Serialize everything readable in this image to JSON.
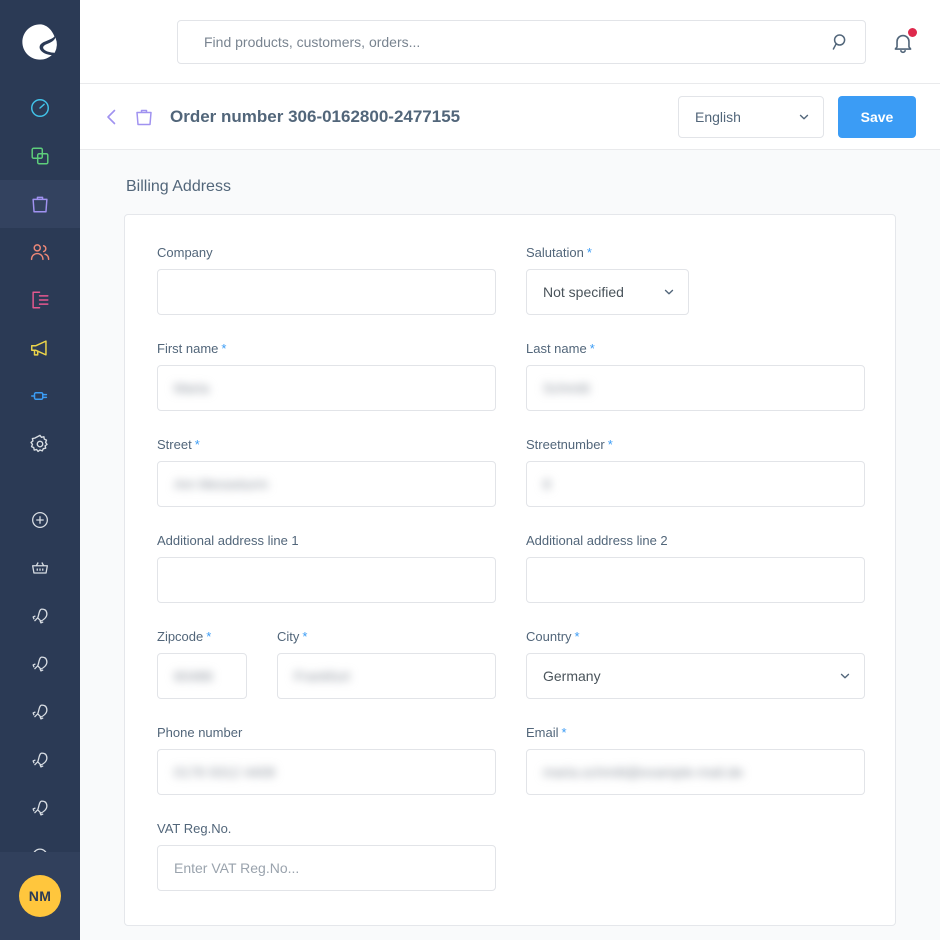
{
  "sidebar": {
    "logo_name": "shopware-logo",
    "avatar_initials": "NM",
    "items": [
      {
        "name": "dashboard",
        "icon": "dashboard-icon",
        "color": "#41c3e9",
        "active": false
      },
      {
        "name": "catalogues",
        "icon": "catalogues-icon",
        "color": "#5ece7b",
        "active": false
      },
      {
        "name": "orders",
        "icon": "orders-icon",
        "color": "#a092f0",
        "active": true
      },
      {
        "name": "customers",
        "icon": "customers-icon",
        "color": "#ed8877",
        "active": false
      },
      {
        "name": "content",
        "icon": "content-icon",
        "color": "#e5588f",
        "active": false
      },
      {
        "name": "marketing",
        "icon": "marketing-icon",
        "color": "#ecd54a",
        "active": false
      },
      {
        "name": "extensions",
        "icon": "extensions-icon",
        "color": "#3b9cf5",
        "active": false
      },
      {
        "name": "settings",
        "icon": "gear-icon",
        "color": "#d8dde3",
        "active": false
      }
    ],
    "apps": [
      {
        "name": "add-app",
        "icon": "plus-circle-icon",
        "color": "#d8dde3"
      },
      {
        "name": "basket-app",
        "icon": "basket-icon",
        "color": "#d8dde3"
      },
      {
        "name": "rocket-app-1",
        "icon": "rocket-icon",
        "color": "#d8dde3"
      },
      {
        "name": "rocket-app-2",
        "icon": "rocket-icon",
        "color": "#d8dde3"
      },
      {
        "name": "rocket-app-3",
        "icon": "rocket-icon",
        "color": "#d8dde3"
      },
      {
        "name": "rocket-app-4",
        "icon": "rocket-icon",
        "color": "#d8dde3"
      },
      {
        "name": "rocket-app-5",
        "icon": "rocket-icon",
        "color": "#d8dde3"
      },
      {
        "name": "expand",
        "icon": "chevron-right-circle-icon",
        "color": "#d8dde3"
      }
    ]
  },
  "search": {
    "placeholder": "Find products, customers, orders...",
    "value": "",
    "icon": "search-icon"
  },
  "notifications": {
    "icon": "bell-icon",
    "has_unread": true,
    "dot_color": "#de294c"
  },
  "toolbar": {
    "back_icon": "chevron-left-icon",
    "order_icon": "orders-icon",
    "title": "Order number 306-0162800-2477155",
    "language": {
      "selected": "English",
      "chevron": "chevron-down-icon"
    },
    "save_label": "Save",
    "save_color": "#3b9cf5"
  },
  "main": {
    "section_title": "Billing Address",
    "fields": {
      "company": {
        "label": "Company",
        "required": false,
        "value": "",
        "placeholder": "",
        "redacted": false
      },
      "salutation": {
        "label": "Salutation",
        "required": true,
        "value": "Not specified",
        "type": "select"
      },
      "first_name": {
        "label": "First name",
        "required": true,
        "value": "Maria",
        "redacted": true
      },
      "last_name": {
        "label": "Last name",
        "required": true,
        "value": "Schmitt",
        "redacted": true
      },
      "street": {
        "label": "Street",
        "required": true,
        "value": "Am Messeturm",
        "redacted": true
      },
      "streetnumber": {
        "label": "Streetnumber",
        "required": true,
        "value": "8",
        "redacted": true
      },
      "address_1": {
        "label": "Additional address line 1",
        "required": false,
        "value": "",
        "placeholder": "",
        "redacted": false
      },
      "address_2": {
        "label": "Additional address line 2",
        "required": false,
        "value": "",
        "placeholder": "",
        "redacted": false
      },
      "zipcode": {
        "label": "Zipcode",
        "required": true,
        "value": "60486",
        "redacted": true
      },
      "city": {
        "label": "City",
        "required": true,
        "value": "Frankfurt",
        "redacted": true
      },
      "country": {
        "label": "Country",
        "required": true,
        "value": "Germany",
        "type": "select"
      },
      "phone": {
        "label": "Phone number",
        "required": false,
        "value": "0176 9312 4408",
        "redacted": true
      },
      "email": {
        "label": "Email",
        "required": true,
        "value": "maria.schmitt@example-mail.de",
        "redacted": true
      },
      "vat": {
        "label": "VAT Reg.No.",
        "required": false,
        "value": "",
        "placeholder": "Enter VAT Reg.No...",
        "redacted": false
      }
    }
  }
}
